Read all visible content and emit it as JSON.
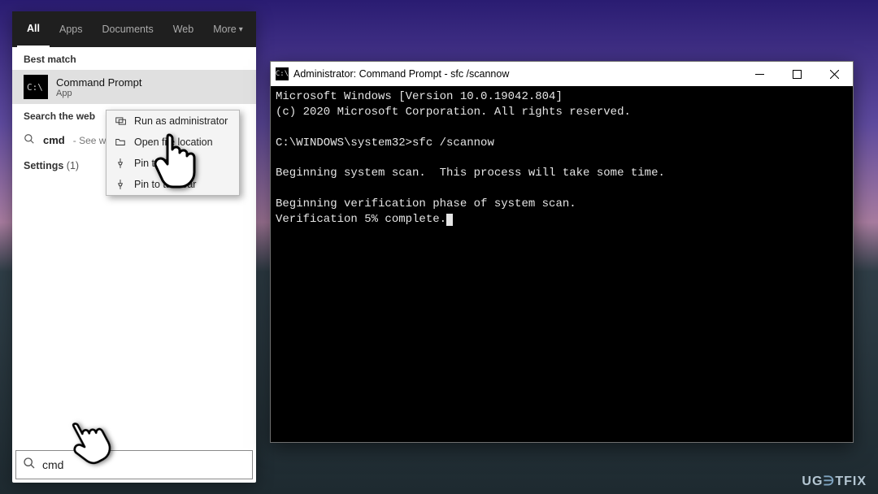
{
  "search": {
    "tabs": {
      "all": "All",
      "apps": "Apps",
      "docs": "Documents",
      "web": "Web",
      "more": "More"
    },
    "best_match_label": "Best match",
    "best_match": {
      "title": "Command Prompt",
      "subtitle": "App"
    },
    "search_web_label": "Search the web",
    "web": {
      "query": "cmd",
      "hint": "- See w"
    },
    "settings_label": "Settings",
    "settings_count": "(1)",
    "input_value": "cmd"
  },
  "context_menu": {
    "run_admin": "Run as administrator",
    "open_loc": "Open file location",
    "pin_start": "Pin to Start",
    "pin_taskbar": "Pin to taskbar"
  },
  "cmd": {
    "title": "Administrator: Command Prompt - sfc  /scannow",
    "lines": {
      "l1": "Microsoft Windows [Version 10.0.19042.804]",
      "l2": "(c) 2020 Microsoft Corporation. All rights reserved.",
      "l3": "",
      "l4": "C:\\WINDOWS\\system32>sfc /scannow",
      "l5": "",
      "l6": "Beginning system scan.  This process will take some time.",
      "l7": "",
      "l8": "Beginning verification phase of system scan.",
      "l9": "Verification 5% complete."
    }
  },
  "watermark": {
    "pre": "UG",
    "mid": "∋",
    "post": "TFIX"
  }
}
